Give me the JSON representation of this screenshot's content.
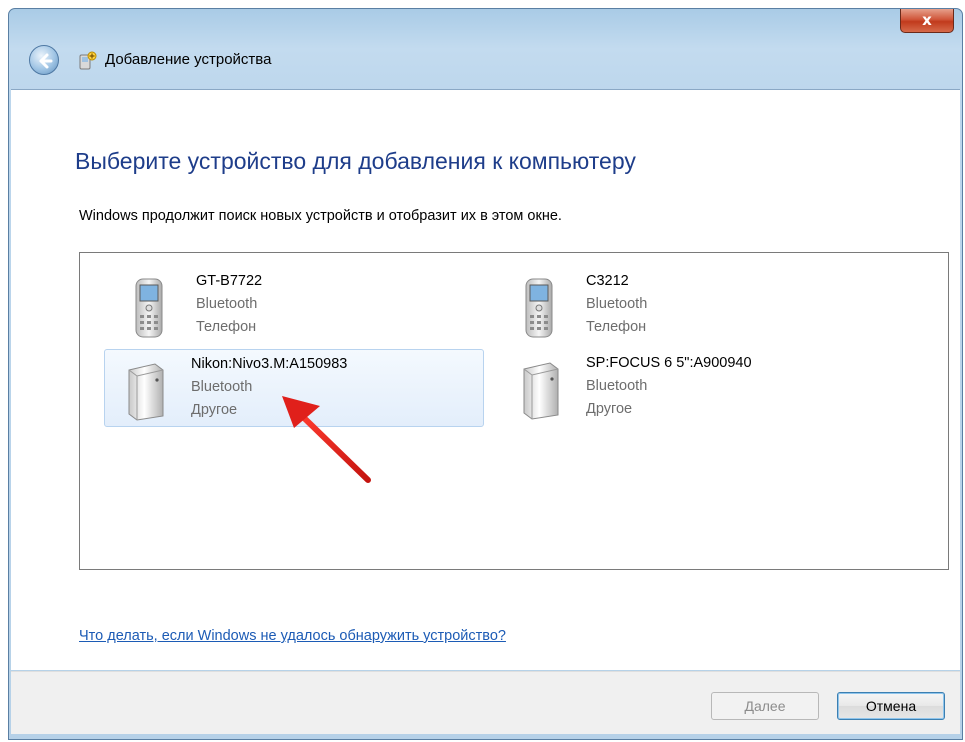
{
  "window": {
    "title": "Добавление устройства",
    "close_label": "x"
  },
  "main": {
    "heading": "Выберите устройство для добавления к компьютеру",
    "subtext": "Windows продолжит поиск новых устройств и отобразит их в этом окне.",
    "devices": [
      {
        "name": "GT-B7722",
        "connection": "Bluetooth",
        "category": "Телефон",
        "icon": "phone-icon",
        "selected": false
      },
      {
        "name": "C3212",
        "connection": "Bluetooth",
        "category": "Телефон",
        "icon": "phone-icon",
        "selected": false
      },
      {
        "name": "Nikon:Nivo3.M:A150983",
        "connection": "Bluetooth",
        "category": "Другое",
        "icon": "generic-device-icon",
        "selected": true
      },
      {
        "name": "SP:FOCUS 6 5\":A900940",
        "connection": "Bluetooth",
        "category": "Другое",
        "icon": "generic-device-icon",
        "selected": false
      }
    ],
    "help_link": "Что делать, если Windows не удалось обнаружить устройство?"
  },
  "footer": {
    "next_label": "Далее",
    "cancel_label": "Отмена"
  },
  "colors": {
    "heading": "#1e3d8a",
    "link": "#1c5bb5",
    "selection": "#e3eefb",
    "annotation_arrow": "#e0201b"
  }
}
